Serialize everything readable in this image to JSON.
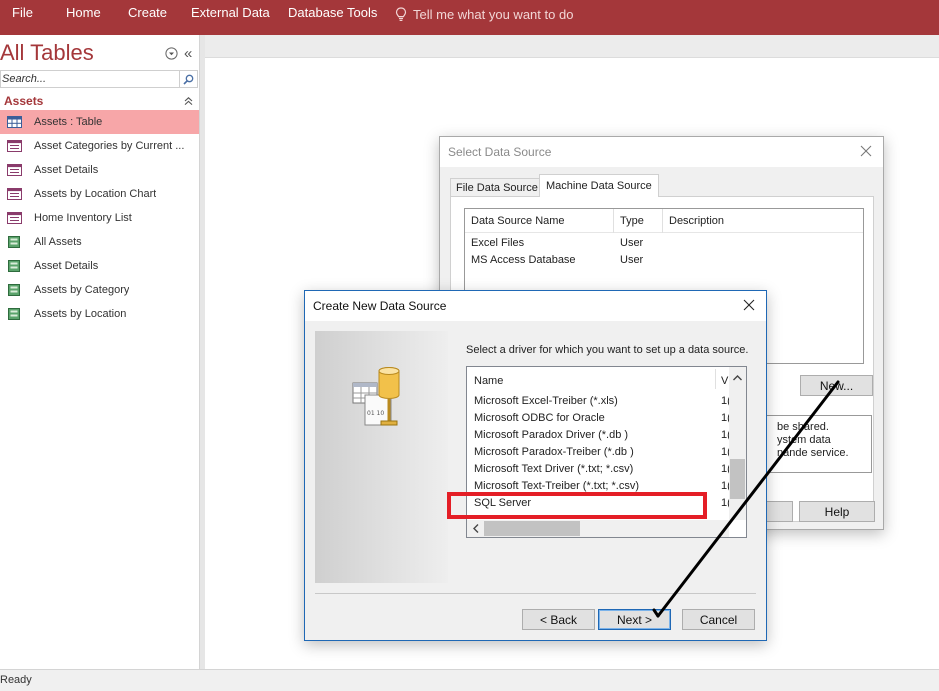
{
  "ribbon": {
    "tabs": [
      "File",
      "Home",
      "Create",
      "External Data",
      "Database Tools"
    ],
    "tell_me": "Tell me what you want to do"
  },
  "nav": {
    "title": "All Tables",
    "search_placeholder": "Search...",
    "group": "Assets",
    "items": [
      {
        "label": "Assets : Table",
        "icon": "table-icon",
        "selected": true
      },
      {
        "label": "Asset Categories by Current ...",
        "icon": "report-icon"
      },
      {
        "label": "Asset Details",
        "icon": "report-icon"
      },
      {
        "label": "Assets by Location Chart",
        "icon": "report-icon"
      },
      {
        "label": "Home Inventory List",
        "icon": "report-icon"
      },
      {
        "label": "All Assets",
        "icon": "form-icon"
      },
      {
        "label": "Asset Details",
        "icon": "form-icon"
      },
      {
        "label": "Assets by Category",
        "icon": "form-icon"
      },
      {
        "label": "Assets by Location",
        "icon": "form-icon"
      }
    ]
  },
  "status": "Ready",
  "select_ds": {
    "title": "Select Data Source",
    "tabs": [
      "File Data Source",
      "Machine Data Source"
    ],
    "columns": [
      "Data Source Name",
      "Type",
      "Description"
    ],
    "rows": [
      {
        "name": "Excel Files",
        "type": "User"
      },
      {
        "name": "MS Access Database",
        "type": "User"
      }
    ],
    "new_label": "New...",
    "info_lines": [
      "be shared.",
      "ystem data",
      "nande service."
    ],
    "cancel_label": "el",
    "help_label": "Help"
  },
  "create_ds": {
    "title": "Create New Data Source",
    "prompt": "Select a driver for which you want to set up a data source.",
    "col_name": "Name",
    "col_version": "V",
    "drivers": [
      "Microsoft Excel-Treiber (*.xls)",
      "Microsoft ODBC for Oracle",
      "Microsoft Paradox Driver (*.db )",
      "Microsoft Paradox-Treiber (*.db )",
      "Microsoft Text Driver (*.txt; *.csv)",
      "Microsoft Text-Treiber (*.txt; *.csv)",
      "SQL Server"
    ],
    "version_prefix": "1(",
    "art_text": "01 10",
    "back_label": "< Back",
    "next_label": "Next >",
    "cancel_label": "Cancel"
  },
  "colors": {
    "ribbon": "#a4373a",
    "selected_item": "#f7a6a8",
    "annotation_red": "#e41e26"
  }
}
